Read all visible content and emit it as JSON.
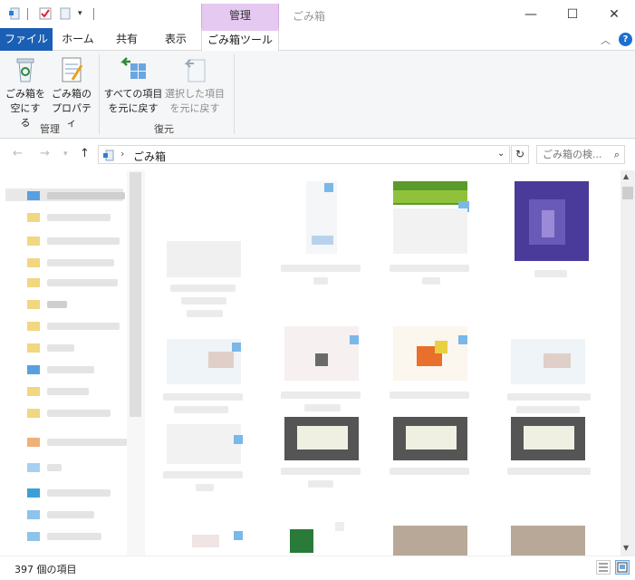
{
  "titlebar": {
    "context_tab": "管理",
    "window_title": "ごみ箱",
    "minimize": "—",
    "maximize": "☐",
    "close": "✕"
  },
  "tabs": {
    "file": "ファイル",
    "home": "ホーム",
    "share": "共有",
    "view": "表示",
    "recycle_tools": "ごみ箱ツール"
  },
  "ribbon": {
    "empty_line1": "ごみ箱を",
    "empty_line2": "空にする",
    "props_line1": "ごみ箱の",
    "props_line2": "プロパティ",
    "group_manage": "管理",
    "restore_all_line1": "すべての項目",
    "restore_all_line2": "を元に戻す",
    "restore_sel_line1": "選択した項目",
    "restore_sel_line2": "を元に戻す",
    "group_restore": "復元"
  },
  "address": {
    "path": "ごみ箱",
    "search_placeholder": "ごみ箱の検..."
  },
  "status": {
    "item_count": "397 個の項目"
  },
  "colors": {
    "file_tab": "#1a5fb4",
    "context_tab": "#e6c9f0",
    "accent": "#1a6fd0"
  }
}
